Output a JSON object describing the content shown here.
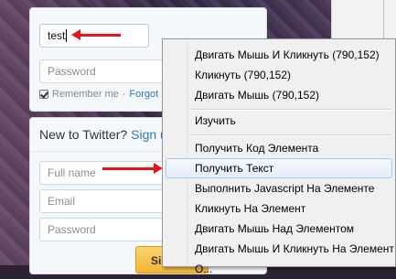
{
  "login": {
    "username_value": "test",
    "password_placeholder": "Password",
    "remember_label": "Remember me",
    "remember_separator": "·",
    "forgot_label": "Forgot p"
  },
  "signup": {
    "heading": "New to Twitter?",
    "signup_link": "Sign u",
    "fullname_placeholder": "Full name",
    "email_placeholder": "Email",
    "password_placeholder": "Password",
    "button_label": "Sig"
  },
  "context_menu": {
    "items": [
      "Двигать Мышь И Кликнуть (790,152)",
      "Кликнуть (790,152)",
      "Двигать Мышь (790,152)",
      "Изучить",
      "Получить Код Элемента",
      "Получить Текст",
      "Выполнить Javascript На Элементе",
      "Кликнуть На Элемент",
      "Двигать Мышь Над Элементом",
      "Двигать Мышь И Кликнуть На Элемент",
      "О..."
    ],
    "highlighted_index": 5
  },
  "colors": {
    "arrow": "#e8141e",
    "link": "#2b7bb9",
    "signup_button": "#f3b532"
  }
}
